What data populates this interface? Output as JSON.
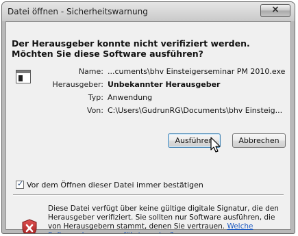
{
  "window": {
    "title": "Datei öffnen - Sicherheitswarnung",
    "close_label": "×"
  },
  "dialog": {
    "heading": "Der Herausgeber konnte nicht verifiziert werden. Möchten Sie diese Software ausführen?",
    "fields": [
      {
        "label": "Name:",
        "value": "...cuments\\bhv Einsteigerseminar PM 2010.exe"
      },
      {
        "label": "Herausgeber:",
        "value": "Unbekannter Herausgeber"
      },
      {
        "label": "Typ:",
        "value": "Anwendung"
      },
      {
        "label": "Von:",
        "value": "C:\\Users\\GudrunRG\\Documents\\bhv Einsteig..."
      }
    ],
    "buttons": {
      "run": "Ausführen",
      "cancel": "Abbrechen"
    },
    "checkbox": {
      "label": "Vor dem Öffnen dieser Datei immer bestätigen",
      "checked": true,
      "check_glyph": "✓"
    },
    "warning": {
      "text": "Diese Datei verfügt über keine gültige digitale Signatur, die den Herausgeber verifiziert. Sie sollten nur Software ausführen, die von Herausgebern stammt, denen Sie vertrauen.",
      "link": "Welche Software kann ausgeführt werden?"
    }
  },
  "icons": {
    "file": "application-file-icon",
    "shield": "security-shield-x-icon",
    "cursor": "mouse-pointer-icon"
  },
  "colors": {
    "link": "#1f5bc0",
    "shield_red": "#b52a2a",
    "default_button_border": "#3c7fb1"
  }
}
